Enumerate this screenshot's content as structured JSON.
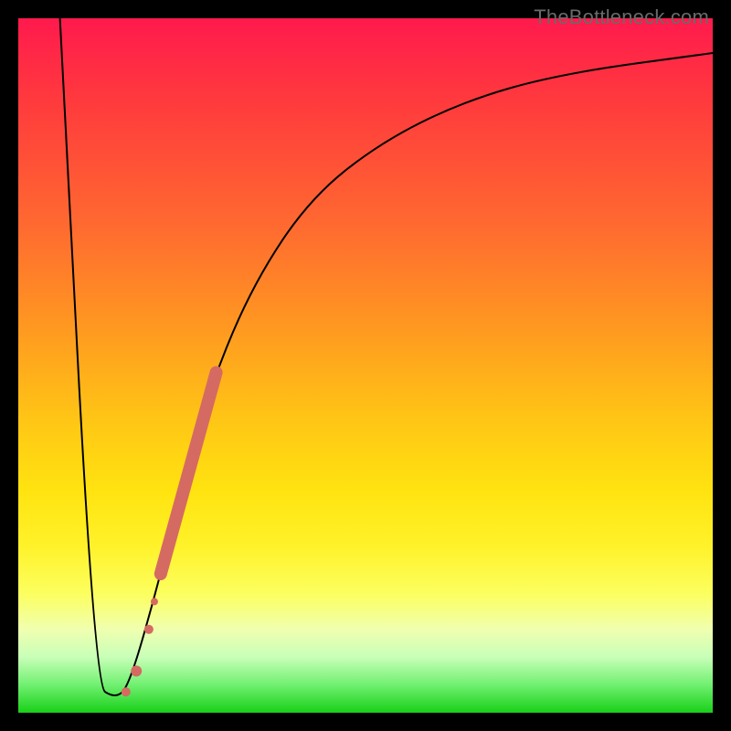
{
  "watermark": "TheBottleneck.com",
  "chart_data": {
    "type": "line",
    "title": "",
    "xlabel": "",
    "ylabel": "",
    "xlim": [
      0,
      100
    ],
    "ylim": [
      0,
      100
    ],
    "series": [
      {
        "name": "bottleneck-curve",
        "style": "line",
        "color": "#000000",
        "points": [
          {
            "x": 6,
            "y": 100
          },
          {
            "x": 11,
            "y": 4
          },
          {
            "x": 14,
            "y": 2
          },
          {
            "x": 16,
            "y": 4
          },
          {
            "x": 20,
            "y": 18
          },
          {
            "x": 24,
            "y": 34
          },
          {
            "x": 28,
            "y": 48
          },
          {
            "x": 34,
            "y": 62
          },
          {
            "x": 42,
            "y": 74
          },
          {
            "x": 52,
            "y": 82
          },
          {
            "x": 64,
            "y": 88
          },
          {
            "x": 78,
            "y": 92
          },
          {
            "x": 100,
            "y": 95
          }
        ]
      },
      {
        "name": "highlight-segment",
        "style": "thick-line",
        "color": "#d56a62",
        "points": [
          {
            "x": 20.5,
            "y": 20
          },
          {
            "x": 28.5,
            "y": 49
          }
        ]
      },
      {
        "name": "highlight-dots",
        "style": "scatter",
        "color": "#d56a62",
        "points": [
          {
            "x": 15.5,
            "y": 3,
            "r": 5
          },
          {
            "x": 17.0,
            "y": 6,
            "r": 6
          },
          {
            "x": 18.8,
            "y": 12,
            "r": 5
          },
          {
            "x": 19.6,
            "y": 16,
            "r": 4
          }
        ]
      }
    ],
    "background_gradient": {
      "direction": "vertical",
      "stops": [
        {
          "pos": 0.0,
          "color": "#ff1a4d"
        },
        {
          "pos": 0.5,
          "color": "#ffc615"
        },
        {
          "pos": 0.85,
          "color": "#fcff60"
        },
        {
          "pos": 1.0,
          "color": "#18d018"
        }
      ]
    }
  }
}
